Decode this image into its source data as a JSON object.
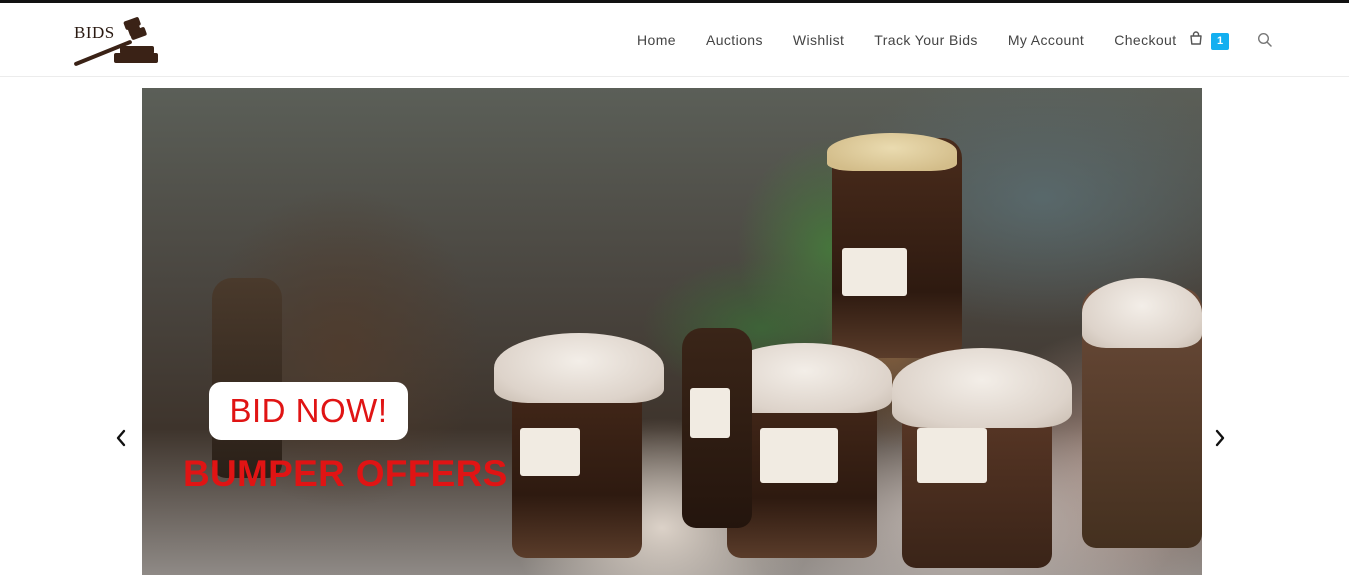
{
  "brand": {
    "logo_text": "BIDS",
    "logo_color": "#2a1a12"
  },
  "nav": {
    "items": [
      {
        "label": "Home"
      },
      {
        "label": "Auctions"
      },
      {
        "label": "Wishlist"
      },
      {
        "label": "Track Your Bids"
      },
      {
        "label": "My Account"
      },
      {
        "label": "Checkout"
      }
    ]
  },
  "cart": {
    "icon": "shopping-bag-icon",
    "count": "1",
    "badge_color": "#13aff0"
  },
  "search": {
    "icon": "search-icon"
  },
  "hero": {
    "badge_text": "BID NOW!",
    "headline": "BUMPER OFFERS",
    "accent_color": "#e01414",
    "prev_icon": "chevron-left-icon",
    "next_icon": "chevron-right-icon"
  }
}
